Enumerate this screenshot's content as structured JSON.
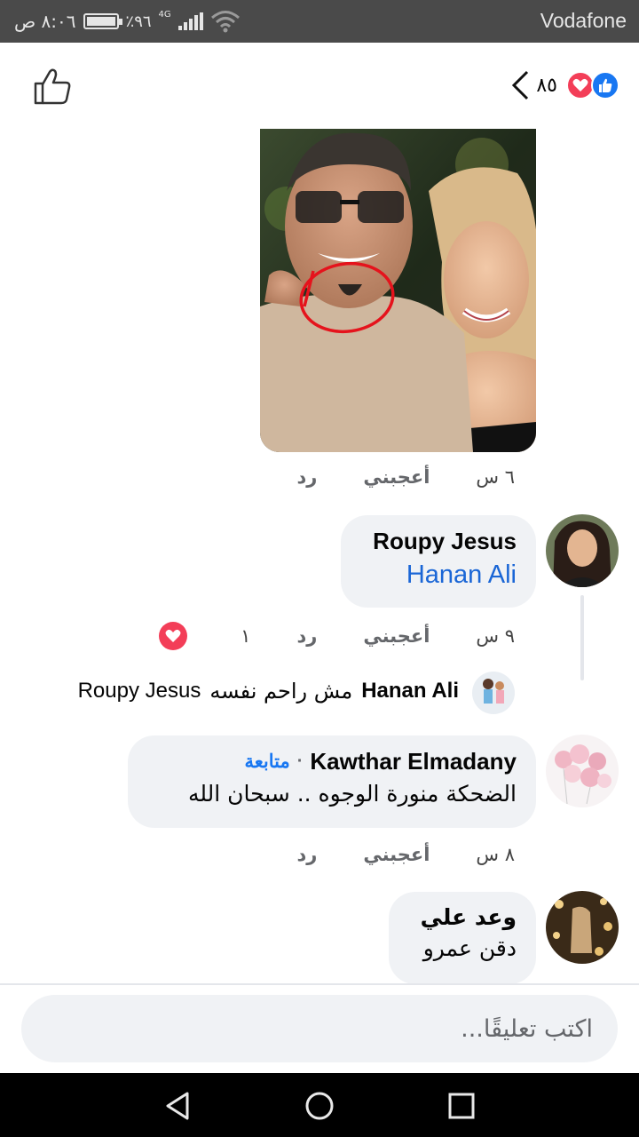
{
  "status_bar": {
    "carrier": "Vodafone",
    "time": "٨:٠٦ ص",
    "battery": "٪٩٦",
    "network": "4G"
  },
  "header": {
    "reaction_count": "٨٥"
  },
  "photo_comment": {
    "time": "٦ س",
    "like_label": "أعجبني",
    "reply_label": "رد"
  },
  "comments": [
    {
      "author": "Roupy Jesus",
      "mention": "Hanan Ali",
      "time": "٩ س",
      "like_label": "أعجبني",
      "reply_label": "رد",
      "reaction_count": "١"
    },
    {
      "author": "Kawthar Elmadany",
      "follow_label": "متابعة",
      "separator": "·",
      "text": "الضحكة منورة الوجوه .. سبحان الله",
      "time": "٨ س",
      "like_label": "أعجبني",
      "reply_label": "رد"
    },
    {
      "author": "وعد علي",
      "text": "دقن عمرو"
    }
  ],
  "reply_preview": {
    "author": "Hanan Ali",
    "text": "مش راحم نفسه",
    "mention": "Roupy Jesus"
  },
  "comment_input": {
    "placeholder": "اكتب تعليقًا..."
  },
  "colors": {
    "accent": "#1877f2",
    "love": "#f33e58",
    "bubble": "#f0f2f5",
    "status_bar": "#4a4a4a"
  }
}
